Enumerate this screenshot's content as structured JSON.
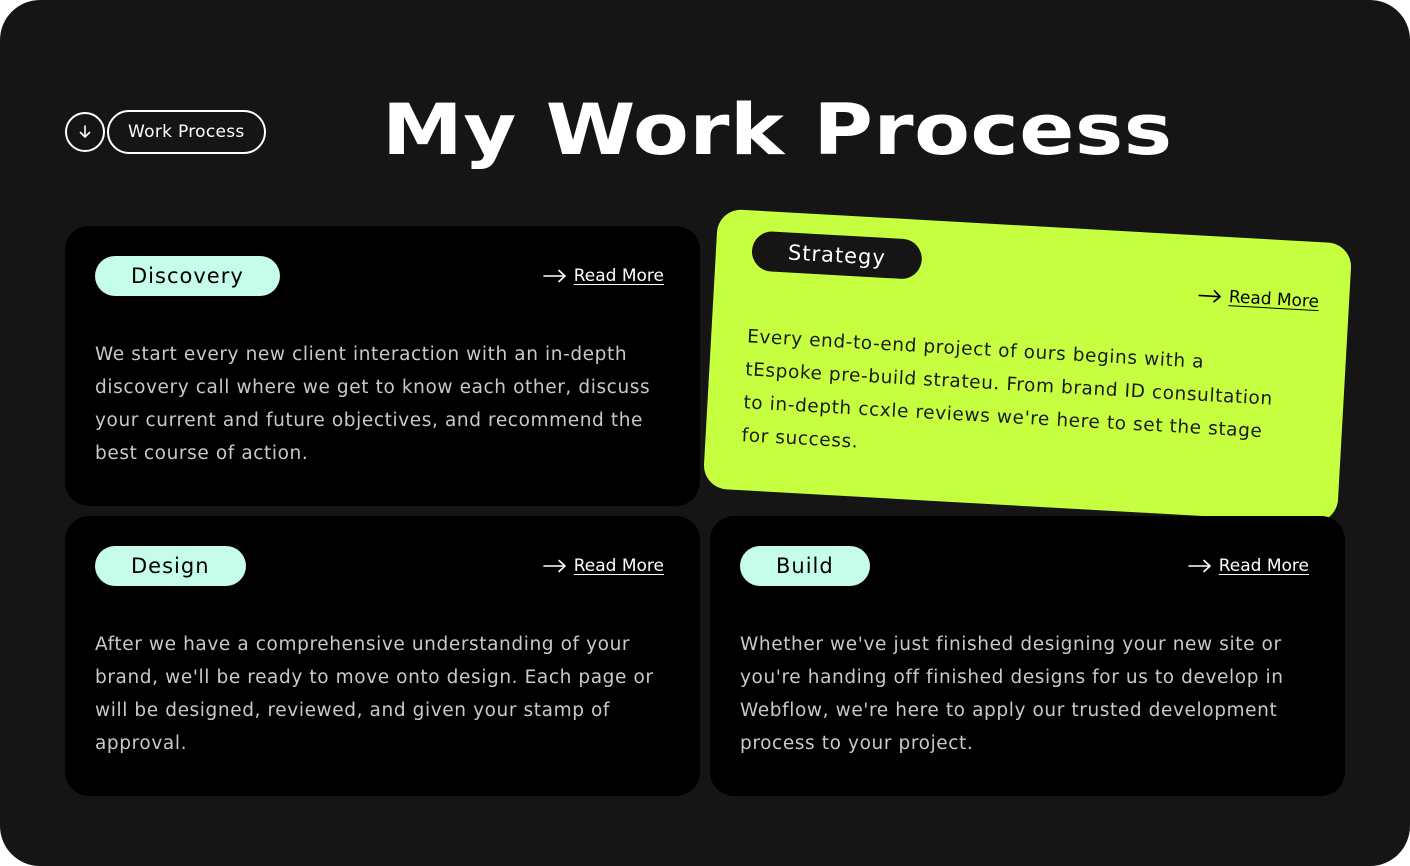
{
  "section_label": "Work Process",
  "title": "My Work Process",
  "cards": [
    {
      "tag": "Discovery",
      "read_more": "Read More",
      "body": "We start every new client interaction with an in-depth discovery call where we get to know each other, discuss your current and future objectives, and recommend the best course of action."
    },
    {
      "tag": "Strategy",
      "read_more": "Read More",
      "body": "Every end-to-end project of ours begins with a tEspoke pre-build strateu. From brand ID consultation to in-depth ccxle reviews we're here to set the stage for success."
    },
    {
      "tag": "Design",
      "read_more": "Read More",
      "body": "After we have a comprehensive understanding of your brand, we'll be ready to move onto design. Each page or will be designed, reviewed, and given your stamp of approval."
    },
    {
      "tag": "Build",
      "read_more": "Read More",
      "body": "Whether we've just finished designing your new site or you're handing off finished designs for us to develop in Webflow, we're here to apply our trusted development process to your project."
    }
  ],
  "colors": {
    "background": "#151515",
    "card": "#000000",
    "highlight_card": "#c6ff3f",
    "tag": "#c6fcea"
  },
  "icons": {
    "section_icon": "arrow-down-icon",
    "read_more_icon": "arrow-right-icon"
  }
}
